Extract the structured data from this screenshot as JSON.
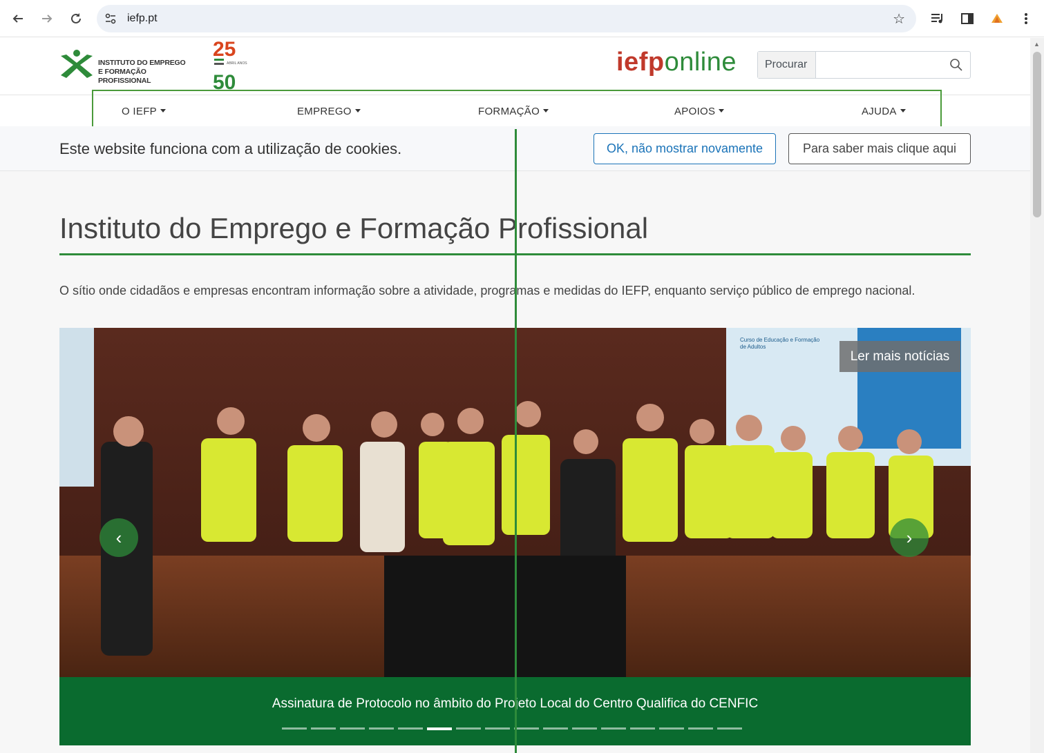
{
  "browser": {
    "url": "iefp.pt",
    "back_icon": "arrow-left-icon",
    "forward_icon": "arrow-right-icon",
    "reload_icon": "reload-icon",
    "bookmark_icon": "star-icon"
  },
  "header": {
    "logo_line1": "INSTITUTO DO EMPREGO",
    "logo_line2": "E FORMAÇÃO PROFISSIONAL",
    "anniversary_top": "25",
    "anniversary_bottom": "50",
    "anniversary_small": "ABRIL ANOS",
    "brand_part1": "iefp",
    "brand_part2": "online",
    "search_label": "Procurar",
    "search_placeholder": ""
  },
  "nav": {
    "items": [
      {
        "label": "O IEFP"
      },
      {
        "label": "EMPREGO"
      },
      {
        "label": "FORMAÇÃO"
      },
      {
        "label": "APOIOS"
      },
      {
        "label": "AJUDA"
      }
    ]
  },
  "cookie_banner": {
    "message": "Este website funciona com a utilização de cookies.",
    "ok_button": "OK, não mostrar novamente",
    "more_button": "Para saber mais clique aqui"
  },
  "main": {
    "title": "Instituto do Emprego e Formação Profissional",
    "lead": "O sítio onde cidadãos e empresas encontram informação sobre a atividade, programas e medidas do IEFP, enquanto serviço público de emprego nacional."
  },
  "carousel": {
    "read_more": "Ler mais notícias",
    "caption": "Assinatura de Protocolo no âmbito do Projeto Local do Centro Qualifica do CENFIC",
    "slide_count": 16,
    "active_index": 5,
    "prev_icon": "chevron-left-icon",
    "next_icon": "chevron-right-icon",
    "slide_text_line1": "Curso de Educação e Formação",
    "slide_text_line2": "de Adultos"
  },
  "colors": {
    "brand_green": "#2e8b3a",
    "brand_red": "#c0392b",
    "caption_green": "#0a6b2f",
    "link_blue": "#1a73b8"
  }
}
